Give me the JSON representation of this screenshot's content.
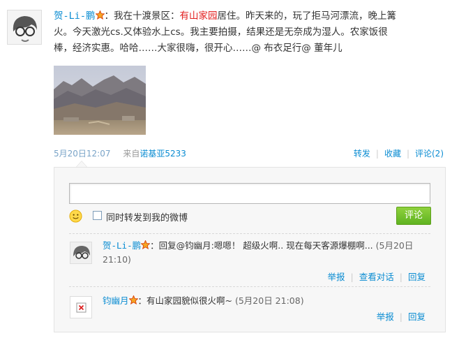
{
  "post": {
    "author": "贺-Li-鹏",
    "text_prefix": "：我在十渡景区：",
    "place": "有山家园",
    "text_line1_rest": "居住。昨天来的，玩了拒马河漂流，晚上篝",
    "text_line2": "火。今天激光cs.又体验水上cs。我主要拍摄，结果还是无奈成为湿人。农家饭很",
    "text_line3": "棒，经济实惠。哈哈……大家很嗨，很开心……@ 布衣足行@ 董年儿",
    "time": "5月20日12:07",
    "source_prefix": "来自",
    "source": "诺基亚5233",
    "actions": {
      "forward": "转发",
      "favorite": "收藏",
      "comment": "评论(2)"
    }
  },
  "comment_form": {
    "input_value": "",
    "checkbox_label": "同时转发到我的微博",
    "submit_label": "评论"
  },
  "comments": [
    {
      "name": "贺-Li-鹏",
      "text": "：回复@钧幽月:嗯嗯！ 超级火啊.. 现在每天客源爆棚啊... ",
      "time": "(5月20日 21:10)",
      "actions": [
        "举报",
        "查看对话",
        "回复"
      ]
    },
    {
      "name": "钧幽月",
      "text": "：有山家园貌似很火啊~ ",
      "time": "(5月20日 21:08)",
      "actions": [
        "举报",
        "回复"
      ]
    }
  ],
  "colors": {
    "link": "#0a8cd2",
    "highlight": "#e21d1d",
    "submit_green": "#5fb321"
  }
}
